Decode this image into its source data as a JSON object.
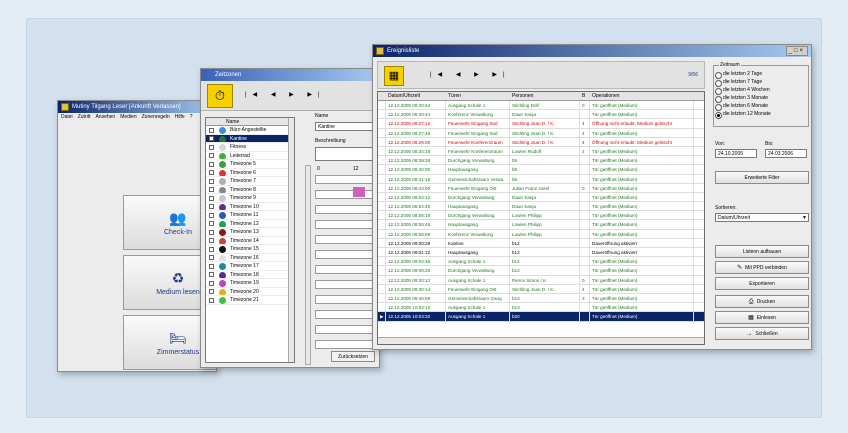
{
  "colors": {
    "accent": "#0a246a",
    "red_text": "#d40000",
    "green_text": "#1a7a1a",
    "yellow_icon": "#f5d100"
  },
  "main_window": {
    "title": "Mutiny Tilgang Leser [Ankunft Verlassen]",
    "menu": [
      "Datei",
      "Zutritt",
      "Ansehen",
      "Medien",
      "Zonenregeln",
      "Hilfe",
      "?"
    ],
    "buttons": [
      {
        "label": "Check-In",
        "icon": "people-icon"
      },
      {
        "label": "Medium lesen",
        "icon": "card-reader-icon"
      },
      {
        "label": "Zimmerstatus",
        "icon": "room-icon"
      }
    ]
  },
  "zone_window": {
    "title": "Zeitzonen",
    "nav": "|◀ ◀ ▶ ▶|",
    "list_header": "Name",
    "zones": [
      {
        "name": "Büro Angestellte",
        "color": "#3a8fd8"
      },
      {
        "name": "Kantine",
        "color": "#1e7a32"
      },
      {
        "name": "Fitness",
        "color": "#d8d8d8"
      },
      {
        "name": "Leiterrad",
        "color": "#40b040"
      },
      {
        "name": "Timezone 5",
        "color": "#3aa040"
      },
      {
        "name": "Timezone 6",
        "color": "#e03030"
      },
      {
        "name": "Timezone 7",
        "color": "#b0b0b0"
      },
      {
        "name": "Timezone 8",
        "color": "#7a8a9a"
      },
      {
        "name": "Timezone 9",
        "color": "#c8c8c8"
      },
      {
        "name": "Timezone 10",
        "color": "#6a2a9a"
      },
      {
        "name": "Timezone 11",
        "color": "#2a5ab0"
      },
      {
        "name": "Timezone 12",
        "color": "#20a050"
      },
      {
        "name": "Timezone 13",
        "color": "#8a1a1a"
      },
      {
        "name": "Timezone 14",
        "color": "#d04040"
      },
      {
        "name": "Timezone 15",
        "color": "#101010"
      },
      {
        "name": "Timezone 16",
        "color": "#e0e0e0"
      },
      {
        "name": "Timezone 17",
        "color": "#1a8aa0"
      },
      {
        "name": "Timezone 18",
        "color": "#5a2a9a"
      },
      {
        "name": "Timezone 19",
        "color": "#c040c0"
      },
      {
        "name": "Timezone 20",
        "color": "#e0b020"
      },
      {
        "name": "Timezone 21",
        "color": "#40c040"
      }
    ],
    "name_label": "Name",
    "name_value": "Kantine",
    "desc_label": "Beschreibung",
    "scale_start": "0",
    "scale_mid": "12",
    "back_button": "Zurücksetzen"
  },
  "log_window": {
    "title": "Ereignisliste",
    "nav": "|◀ ◀ ▶ ▶|",
    "nav_status": "9/56",
    "columns": [
      "",
      "Datum/Uhrzeit",
      "Türen",
      "Personen",
      "B",
      "Operationen",
      ""
    ],
    "rows": [
      {
        "date": "12.12.2005 08:20:44",
        "door": "Ausgang Schale 1",
        "person": "Stichling Dolf",
        "b": "0",
        "op": "Tür geöffnet (Medium)",
        "color": "green"
      },
      {
        "date": "12.12.2005 08:20:44",
        "door": "Konferenz Verwaltung",
        "person": "Daun Sanja",
        "b": "",
        "op": "Tür geöffnet (Medium)",
        "color": "green"
      },
      {
        "date": "12.12.2005 08:27:12",
        "door": "Feuerwehr Eingang Süd",
        "person": "Stichling Joan D. / K.",
        "b": "4",
        "op": "Öffnung nicht erlaubt: Medium gelöscht",
        "color": "red"
      },
      {
        "date": "12.12.2005 08:27:48",
        "door": "Feuerwehr Eingang Süd",
        "person": "Stichling Joan D. / K.",
        "b": "4",
        "op": "Tür geöffnet (Medium)",
        "color": "green"
      },
      {
        "date": "12.12.2005 08:29:00",
        "door": "Feuerwehr Konferenzraum",
        "person": "Stichling Joan D. / K.",
        "b": "4",
        "op": "Öffnung nicht erlaubt: Medium gelöscht",
        "color": "red"
      },
      {
        "date": "12.12.2005 08:34:16",
        "door": "Feuerwehr Konferenzraum",
        "person": "Lowien Rudolf",
        "b": "2",
        "op": "Tür geöffnet (Medium)",
        "color": "green"
      },
      {
        "date": "12.12.2005 08:39:26",
        "door": "Durchgang Verwaltung",
        "person": "b5",
        "b": "",
        "op": "Tür geöffnet (Medium)",
        "color": "green"
      },
      {
        "date": "12.12.2005 08:40:00",
        "door": "Hauptausgang",
        "person": "b5",
        "b": "",
        "op": "Tür geöffnet (Medium)",
        "color": "green"
      },
      {
        "date": "12.12.2005 08:41:16",
        "door": "Gemeinschaftsraum Verwa.",
        "person": "b5",
        "b": "",
        "op": "Tür geöffnet (Medium)",
        "color": "green"
      },
      {
        "date": "12.12.2005 08:43:00",
        "door": "Feuerwehr Eingang Ost",
        "person": "Julian Franz Josef",
        "b": "0",
        "op": "Tür geöffnet (Medium)",
        "color": "green"
      },
      {
        "date": "12.12.2005 08:54:12",
        "door": "Durchgang Verwaltung",
        "person": "Daun Sanja",
        "b": "",
        "op": "Tür geöffnet (Medium)",
        "color": "green"
      },
      {
        "date": "12.12.2005 08:54:48",
        "door": "Hauptausgang",
        "person": "Daun Sanja",
        "b": "",
        "op": "Tür geöffnet (Medium)",
        "color": "green"
      },
      {
        "date": "12.12.2005 08:55:16",
        "door": "Durchgang Verwaltung",
        "person": "Lowien Philipp",
        "b": "",
        "op": "Tür geöffnet (Medium)",
        "color": "green"
      },
      {
        "date": "12.12.2005 08:55:46",
        "door": "Hauptausgang",
        "person": "Lowien Philipp",
        "b": "",
        "op": "Tür geöffnet (Medium)",
        "color": "green"
      },
      {
        "date": "12.12.2005 08:55:58",
        "door": "Konferenz Verwaltung",
        "person": "Lowien Philipp",
        "b": "",
        "op": "Tür geöffnet (Medium)",
        "color": "green"
      },
      {
        "date": "12.12.2005 09:00:28",
        "door": "Kantine",
        "person": "b12",
        "b": "",
        "op": "Daueröffnung aktiviert",
        "color": "black"
      },
      {
        "date": "12.12.2005 09:01:12",
        "door": "Hauptausgang",
        "person": "b12",
        "b": "",
        "op": "Daueröffnung aktiviert",
        "color": "black"
      },
      {
        "date": "12.12.2005 09:04:46",
        "door": "Ausgang Schale 1",
        "person": "b12",
        "b": "",
        "op": "Tür geöffnet (Medium)",
        "color": "green"
      },
      {
        "date": "12.12.2005 09:09:20",
        "door": "Durchgang Verwaltung",
        "person": "b12",
        "b": "",
        "op": "Tür geöffnet (Medium)",
        "color": "green"
      },
      {
        "date": "12.12.2005 09:30:12",
        "door": "Ausgang Schale 1",
        "person": "Pierce Simon / K.",
        "b": "0",
        "op": "Tür geöffnet (Medium)",
        "color": "green"
      },
      {
        "date": "12.12.2005 09:30:14",
        "door": "Feuerwehr Eingang Ost",
        "person": "Stichling Joan D. / K.",
        "b": "4",
        "op": "Tür geöffnet (Medium)",
        "color": "green"
      },
      {
        "date": "12.12.2005 09:46:58",
        "door": "Gemeinschaftsraum Gang",
        "person": "b13",
        "b": "3",
        "op": "Tür geöffnet (Medium)",
        "color": "green"
      },
      {
        "date": "12.12.2005 10:02:12",
        "door": "Ausgang Schale 1",
        "person": "b13",
        "b": "",
        "op": "Tür geöffnet (Medium)",
        "color": "green"
      },
      {
        "date": "12.12.2005 10:03:32",
        "door": "Ausgang Schale 1",
        "person": "b20",
        "b": "",
        "op": "Tür geöffnet (Medium)",
        "color": "selected"
      }
    ],
    "period_group": "Zeitraum",
    "periods": [
      {
        "label": "die letzten 2 Tage",
        "on": false
      },
      {
        "label": "die letzten 7 Tage",
        "on": false
      },
      {
        "label": "die letzten 4 Wochen",
        "on": false
      },
      {
        "label": "die letzten 3 Monate",
        "on": false
      },
      {
        "label": "die letzten 6 Monate",
        "on": false
      },
      {
        "label": "die letzten 12 Monate",
        "on": true
      }
    ],
    "from_label": "Von:",
    "to_label": "Bis:",
    "from_value": "24.10.2005",
    "to_value": "24.03.2006",
    "advanced_filter": "Erweiterte Filter",
    "sort_label": "Sortieren:",
    "sort_value": "Datum/Uhrzeit",
    "actions": [
      {
        "label": "Listenn aufbauen",
        "icon": ""
      },
      {
        "label": "Mit PPD verbinden",
        "icon": "✎"
      },
      {
        "label": "Exportieren",
        "icon": ""
      },
      {
        "label": "Drucken",
        "icon": "⎙"
      },
      {
        "label": "Einlesen",
        "icon": "▦"
      },
      {
        "label": "Schließen",
        "icon": "→"
      }
    ]
  }
}
